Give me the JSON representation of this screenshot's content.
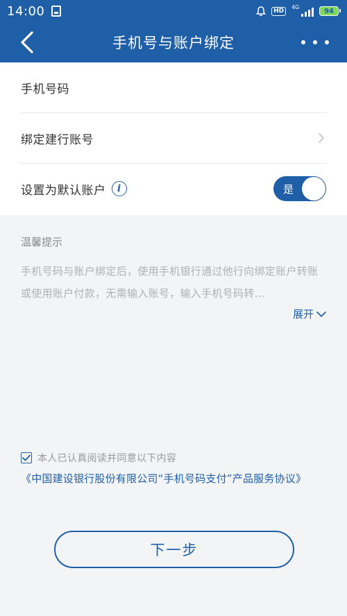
{
  "status_bar": {
    "time": "14:00",
    "hd_label": "HD",
    "network_label": "4G",
    "battery_level": "94"
  },
  "header": {
    "title": "手机号与账户绑定",
    "back_icon": "back-chevron-icon",
    "more_icon": "more-dots-icon"
  },
  "form": {
    "phone_label": "手机号码",
    "account_label": "绑定建行账号",
    "default_label": "设置为默认账户",
    "toggle_label": "是",
    "toggle_on": true
  },
  "tips": {
    "title": "温馨提示",
    "body": "手机号码与账户绑定后，使用手机银行通过他行向绑定账户转账或使用账户付款，无需输入账号，输入手机号码转...",
    "expand_label": "展开"
  },
  "agreement": {
    "checked": true,
    "text": "本人已认真阅读并同意以下内容",
    "link_text": "《中国建设银行股份有限公司“手机号码支付”产品服务协议》"
  },
  "actions": {
    "next_label": "下一步"
  },
  "colors": {
    "brand": "#1f5fa8",
    "battery": "#7ed957"
  }
}
